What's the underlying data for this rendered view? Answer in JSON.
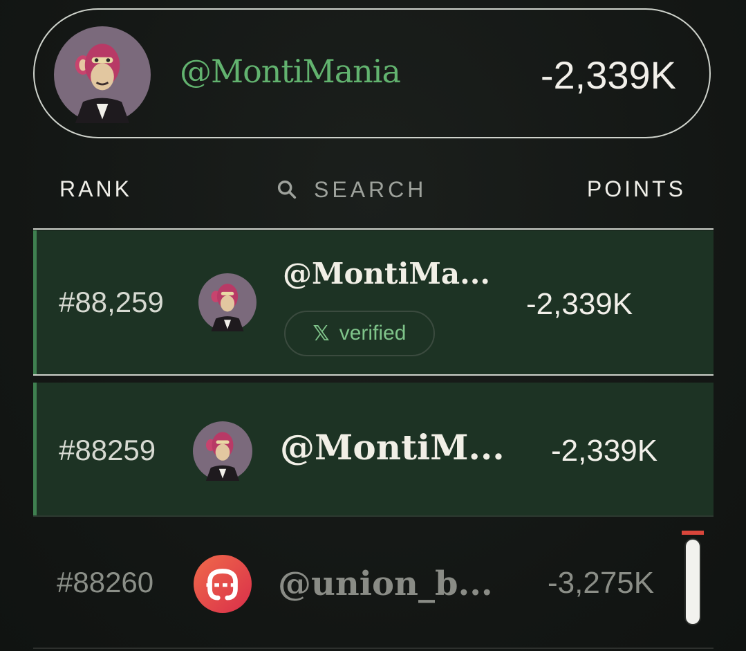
{
  "profile": {
    "handle": "@MontiMania",
    "points": "-2,339K",
    "avatar_icon": "ape-avatar-icon"
  },
  "header": {
    "rank_label": "RANK",
    "search_label": "SEARCH",
    "points_label": "POINTS"
  },
  "rows": [
    {
      "rank": "#88,259",
      "handle": "@MontiMa...",
      "badge_label": "verified",
      "badge_icon": "x-logo-icon",
      "points": "-2,339K",
      "avatar_icon": "ape-avatar-icon"
    },
    {
      "rank": "#88259",
      "handle": "@MontiM...",
      "points": "-2,339K",
      "avatar_icon": "ape-avatar-icon"
    },
    {
      "rank": "#88260",
      "handle": "@union_b...",
      "points": "-3,275K",
      "avatar_icon": "union-logo-icon"
    }
  ],
  "colors": {
    "accent_green": "#62b36f",
    "highlight_row": "#1d3324",
    "background": "#151816",
    "union_red": "#e8443c"
  }
}
